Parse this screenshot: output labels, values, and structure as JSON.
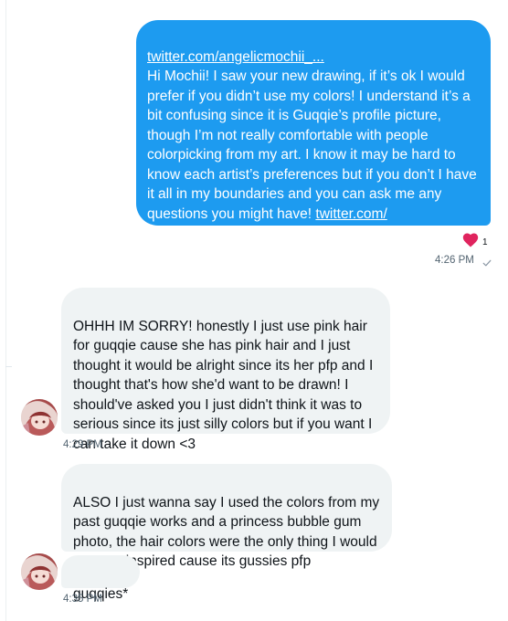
{
  "conversation": {
    "sent_message": {
      "link_top": "twitter.com/angelicmochii_...",
      "body": "Hi Mochii! I saw your new drawing, if it’s ok I would prefer if you didn’t use my colors! I understand it’s a bit confusing since it is Guqqie’s profile picture, though I’m not really comfortable with people colorpicking from my art. I know it may be hard to know each artist’s preferences but if you don’t I have it all in my boundaries and you can ask me any questions you might have! ",
      "link_bottom": "twitter.com/\nAngelicMochii_...",
      "reaction_icon": "heart-icon",
      "reaction_count": "1",
      "timestamp": "4:26 PM",
      "status_icon": "checkmark-icon"
    },
    "received_messages": [
      {
        "text": "OHHH IM SORRY! honestly I just use pink hair for guqqie cause she has pink hair and I just thought it would be alright since its her pfp and I thought that's how she'd want to be drawn! I should've asked you I just didn't think it was to serious since its just silly colors but if you want I can take it down <3",
        "timestamp": "4:29 PM"
      },
      {
        "text": "ALSO I just wanna say I used the colors from my past guqqie works and a princess bubble gum photo, the hair colors were the only thing I would say you inspired cause its gussies pfp"
      },
      {
        "text": "guqqies*",
        "timestamp": "4:35 PM"
      }
    ]
  },
  "colors": {
    "sent_bubble": "#1d9bf0",
    "received_bubble": "#eff3f4",
    "reaction_heart": "#e0245e",
    "timestamp_text": "#536471"
  }
}
